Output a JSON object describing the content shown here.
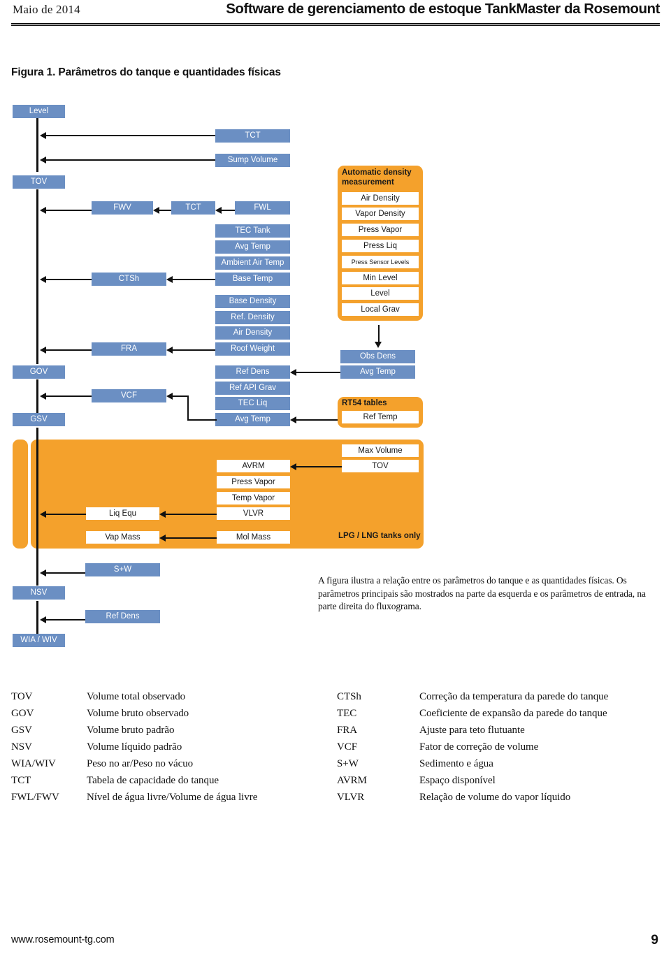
{
  "header": {
    "date": "Maio de 2014",
    "title": "Software de gerenciamento de estoque TankMaster da Rosemount"
  },
  "figure": {
    "caption": "Figura 1. Parâmetros do tanque e quantidades físicas",
    "explanation": "A figura ilustra a relação entre os parâmetros do tanque e as quantidades físicas. Os parâmetros principais são mostrados na parte da esquerda e os parâmetros de entrada, na parte direita do fluxograma."
  },
  "colors": {
    "blue_box": "#6b8fc3",
    "orange_panel": "#f4a12c",
    "line": "#111111",
    "white_box": "#ffffff"
  },
  "diagram": {
    "spine_nodes": [
      {
        "label": "Level"
      },
      {
        "label": "TOV"
      },
      {
        "label": "GOV"
      },
      {
        "label": "GSV"
      },
      {
        "label": "NSV"
      },
      {
        "label": "WIA / WIV"
      }
    ],
    "blue_boxes": [
      {
        "label": "TCT"
      },
      {
        "label": "Sump Volume"
      },
      {
        "label": "FWV"
      },
      {
        "label": "TCT"
      },
      {
        "label": "FWL"
      },
      {
        "label": "TEC Tank"
      },
      {
        "label": "Avg Temp"
      },
      {
        "label": "Ambient Air Temp"
      },
      {
        "label": "CTSh"
      },
      {
        "label": "Base Temp"
      },
      {
        "label": "Base Density"
      },
      {
        "label": "Ref. Density"
      },
      {
        "label": "Air Density"
      },
      {
        "label": "FRA"
      },
      {
        "label": "Roof Weight"
      },
      {
        "label": "Ref Dens"
      },
      {
        "label": "Ref API Grav"
      },
      {
        "label": "VCF"
      },
      {
        "label": "TEC Liq"
      },
      {
        "label": "Avg Temp"
      },
      {
        "label": "Obs Dens"
      },
      {
        "label": "Avg Temp"
      },
      {
        "label": "S+W"
      },
      {
        "label": "Ref Dens"
      }
    ],
    "auto_density_panel": {
      "title": "Automatic density measurement",
      "items": [
        "Air Density",
        "Vapor Density",
        "Press Vapor",
        "Press Liq",
        "Press Sensor Levels",
        "Min Level",
        "Level",
        "Local Grav"
      ]
    },
    "rt54_panel": {
      "title": "RT54 tables",
      "items": [
        "Ref Temp"
      ]
    },
    "lpg_panel": {
      "caption": "LPG / LNG tanks only",
      "items": [
        "Max Volume",
        "TOV",
        "AVRM",
        "Press Vapor",
        "Temp Vapor",
        "VLVR",
        "Liq Equ",
        "Vap Mass",
        "Mol Mass"
      ]
    }
  },
  "glossary": {
    "left": [
      {
        "abbr": "TOV",
        "desc": "Volume total observado"
      },
      {
        "abbr": "GOV",
        "desc": "Volume bruto observado"
      },
      {
        "abbr": "GSV",
        "desc": "Volume bruto padrão"
      },
      {
        "abbr": "NSV",
        "desc": "Volume líquido padrão"
      },
      {
        "abbr": "WIA/WIV",
        "desc": "Peso no ar/Peso no vácuo"
      },
      {
        "abbr": "TCT",
        "desc": "Tabela de capacidade do tanque"
      },
      {
        "abbr": "FWL/FWV",
        "desc": "Nível de água livre/Volume de água livre"
      }
    ],
    "right": [
      {
        "abbr": "CTSh",
        "desc": "Correção da temperatura da parede do tanque"
      },
      {
        "abbr": "TEC",
        "desc": "Coeficiente de expansão da parede do tanque"
      },
      {
        "abbr": "FRA",
        "desc": "Ajuste para teto flutuante"
      },
      {
        "abbr": "VCF",
        "desc": "Fator de correção de volume"
      },
      {
        "abbr": "S+W",
        "desc": "Sedimento e água"
      },
      {
        "abbr": "AVRM",
        "desc": "Espaço disponível"
      },
      {
        "abbr": "VLVR",
        "desc": "Relação de volume do vapor líquido"
      }
    ]
  },
  "footer": {
    "url": "www.rosemount-tg.com",
    "page": "9"
  }
}
